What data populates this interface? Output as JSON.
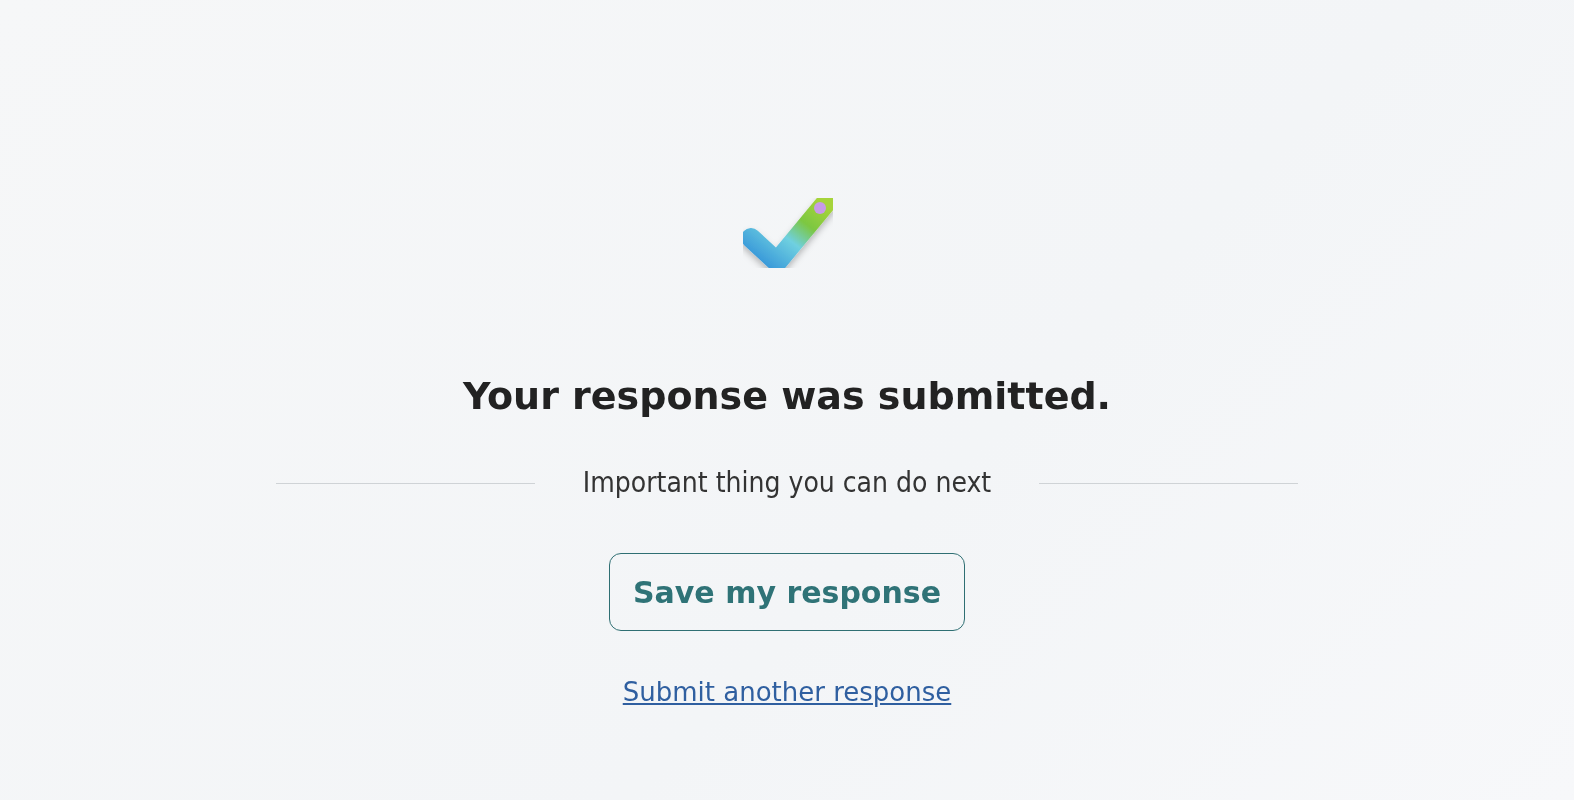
{
  "title": "Your response was submitted.",
  "next_heading": "Important thing you can do next",
  "primary_button": {
    "label": "Save my response"
  },
  "link": {
    "label": "Submit another response"
  }
}
